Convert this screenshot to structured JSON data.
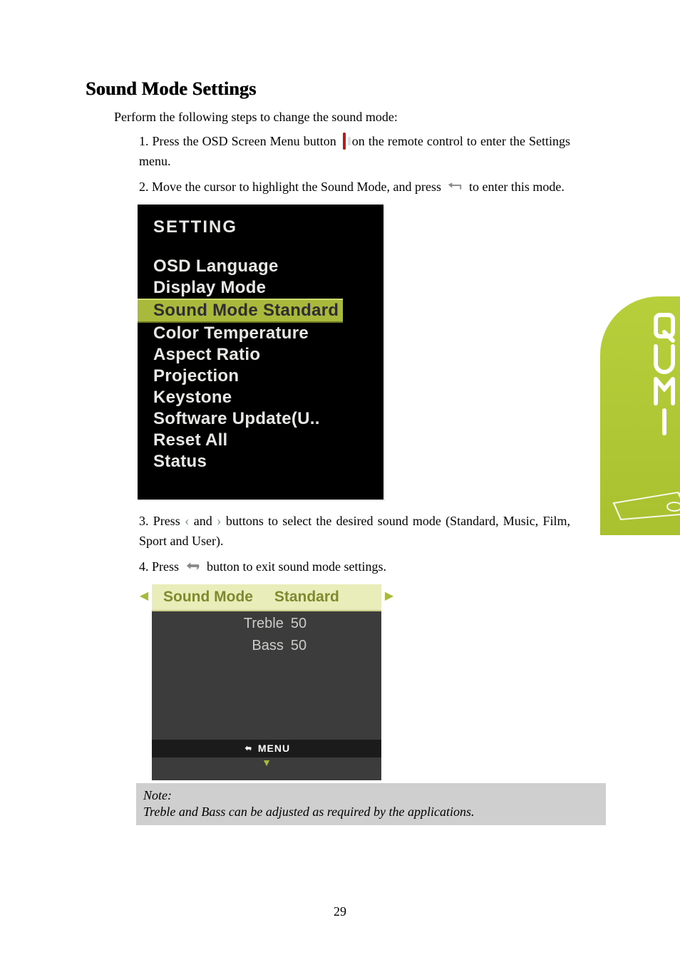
{
  "heading": "Sound Mode Settings",
  "intro": "Perform the following steps to change the sound mode:",
  "step1_a": "1. Press the OSD Screen Menu button ",
  "step1_b": " on the remote control to enter the Settings menu.",
  "step2_a": "2. Move the cursor to highlight the Sound Mode, and press ",
  "step2_b": " to enter this mode.",
  "setting_panel": {
    "title": "SETTING",
    "items": [
      "OSD Language",
      "Display Mode",
      "Sound Mode Standard",
      "Color Temperature",
      "Aspect Ratio",
      "Projection",
      "Keystone",
      "Software Update(U..",
      "Reset All",
      "Status"
    ],
    "highlight_index": 2
  },
  "step3_a": "3. Press ",
  "step3_b": " and ",
  "step3_c": " buttons to select the desired sound mode (Standard, Music, Film, Sport and User).",
  "step4_a": "4. Press ",
  "step4_b": " button to exit sound mode settings.",
  "submenu": {
    "header_label": "Sound Mode",
    "header_value": "Standard",
    "rows": [
      {
        "label": "Treble",
        "value": "50"
      },
      {
        "label": "Bass",
        "value": "50"
      }
    ],
    "footer": "MENU"
  },
  "note": {
    "title": "Note:",
    "text": "Treble and Bass can be adjusted as required by the applications."
  },
  "page_number": "29",
  "brand": "QUMI"
}
